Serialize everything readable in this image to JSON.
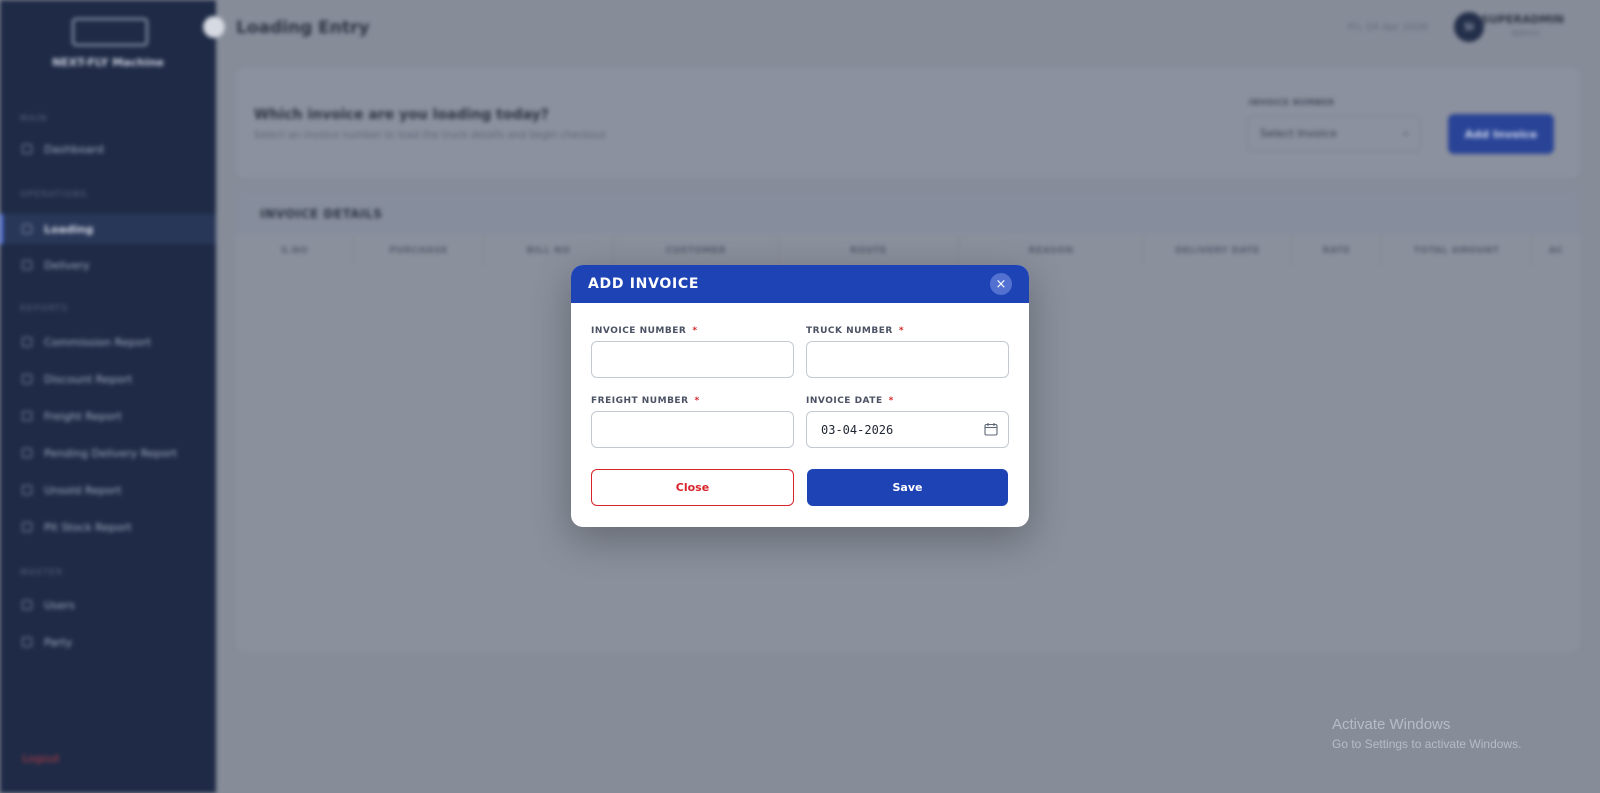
{
  "sidebar": {
    "brand": "NEXT-FLY Machine",
    "sections": [
      "MAIN",
      "OPERATIONS",
      "REPORTS",
      "MASTER"
    ],
    "items": [
      {
        "label": "Dashboard"
      },
      {
        "label": "Loading"
      },
      {
        "label": "Delivery"
      },
      {
        "label": "Commission Report"
      },
      {
        "label": "Discount Report"
      },
      {
        "label": "Freight Report"
      },
      {
        "label": "Pending Delivery Report"
      },
      {
        "label": "Unsold Report"
      },
      {
        "label": "Pit Stock Report"
      },
      {
        "label": "Users"
      },
      {
        "label": "Party"
      }
    ],
    "logout": "Logout"
  },
  "header": {
    "title": "Loading Entry",
    "date": "Fri, 04 Apr 2026",
    "user_initials": "SI",
    "user_name": "SUPERADMIN",
    "user_role": "Admin"
  },
  "invoice_select": {
    "question": "Which invoice are you loading today?",
    "subtext": "Select an invoice number to load the truck details and begin checkout",
    "label": "INVOICE NUMBER",
    "value": "Select Invoice",
    "add_label": "Add Invoice"
  },
  "invoice_details": {
    "title": "INVOICE DETAILS",
    "columns": [
      "S.NO",
      "PURCHASE",
      "BILL NO",
      "CUSTOMER",
      "ROUTE",
      "REASON",
      "DELIVERY DATE",
      "RATE",
      "TOTAL AMOUNT",
      "AC"
    ]
  },
  "watermark": {
    "line1": "Activate Windows",
    "line2": "Go to Settings to activate Windows."
  },
  "modal": {
    "title": "ADD INVOICE",
    "invoice_number_label": "INVOICE NUMBER",
    "truck_number_label": "TRUCK NUMBER",
    "freight_number_label": "FREIGHT NUMBER",
    "invoice_date_label": "INVOICE DATE",
    "required_mark": "*",
    "invoice_number_value": "",
    "truck_number_value": "",
    "freight_number_value": "",
    "invoice_date_value": "03-04-2026",
    "close_label": "Close",
    "save_label": "Save",
    "close_icon": "×"
  },
  "colors": {
    "primary": "#1d43b5",
    "danger": "#d9232a",
    "sidebar_bg": "#0f1c3a"
  }
}
